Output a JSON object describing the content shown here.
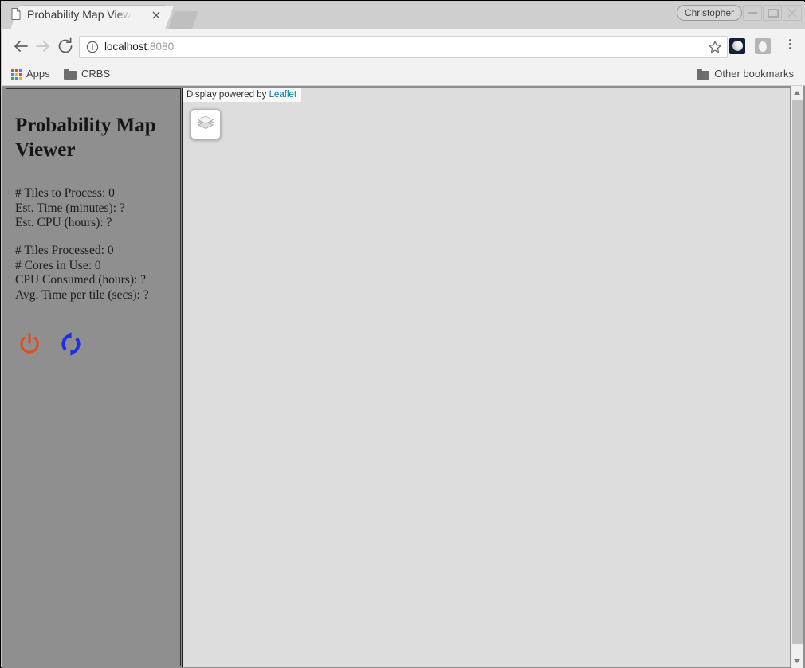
{
  "window": {
    "profile_name": "Christopher",
    "minimize_label": "Minimize",
    "maximize_label": "Maximize",
    "close_label": "Close"
  },
  "tab": {
    "title": "Probability Map Viewer",
    "favicon": "document-icon",
    "close_label": "Close tab",
    "new_tab_label": "New tab"
  },
  "toolbar": {
    "back_label": "Back",
    "forward_label": "Forward",
    "reload_label": "Reload",
    "url_host": "localhost",
    "url_port": ":8080",
    "url_full": "localhost:8080",
    "info_icon": "info-circle-icon",
    "star_label": "Bookmark this page",
    "menu_label": "Customize and control Google Chrome",
    "extensions": [
      {
        "name": "moon-extension-icon",
        "color": "#11203c"
      },
      {
        "name": "shield-extension-icon",
        "color": "#b5b5b5"
      }
    ]
  },
  "bookmarks": {
    "apps_label": "Apps",
    "items": [
      {
        "label": "CRBS",
        "icon": "folder-icon"
      }
    ],
    "other_label": "Other bookmarks"
  },
  "sidebar": {
    "title": "Probability Map Viewer",
    "stats_group_1": [
      "# Tiles to Process: 0",
      "Est. Time (minutes): ?",
      "Est. CPU (hours): ?"
    ],
    "stats_group_2": [
      "# Tiles Processed: 0",
      "# Cores in Use: 0",
      "CPU Consumed (hours): ?",
      "Avg. Time per tile (secs): ?"
    ],
    "actions": [
      {
        "name": "power-off-icon",
        "label": "Shut down",
        "color": "#e8491d"
      },
      {
        "name": "refresh-icon",
        "label": "Refresh",
        "color": "#1f2fe8"
      }
    ],
    "background_color": "#8f8f8f"
  },
  "map": {
    "attribution_prefix": "Display powered by ",
    "attribution_link": "Leaflet",
    "layers_control_label": "Layers",
    "background_color": "#dddddd"
  },
  "scrollbar": {
    "up_label": "Scroll up",
    "down_label": "Scroll down",
    "thumb_label": "Vertical scrollbar thumb"
  }
}
